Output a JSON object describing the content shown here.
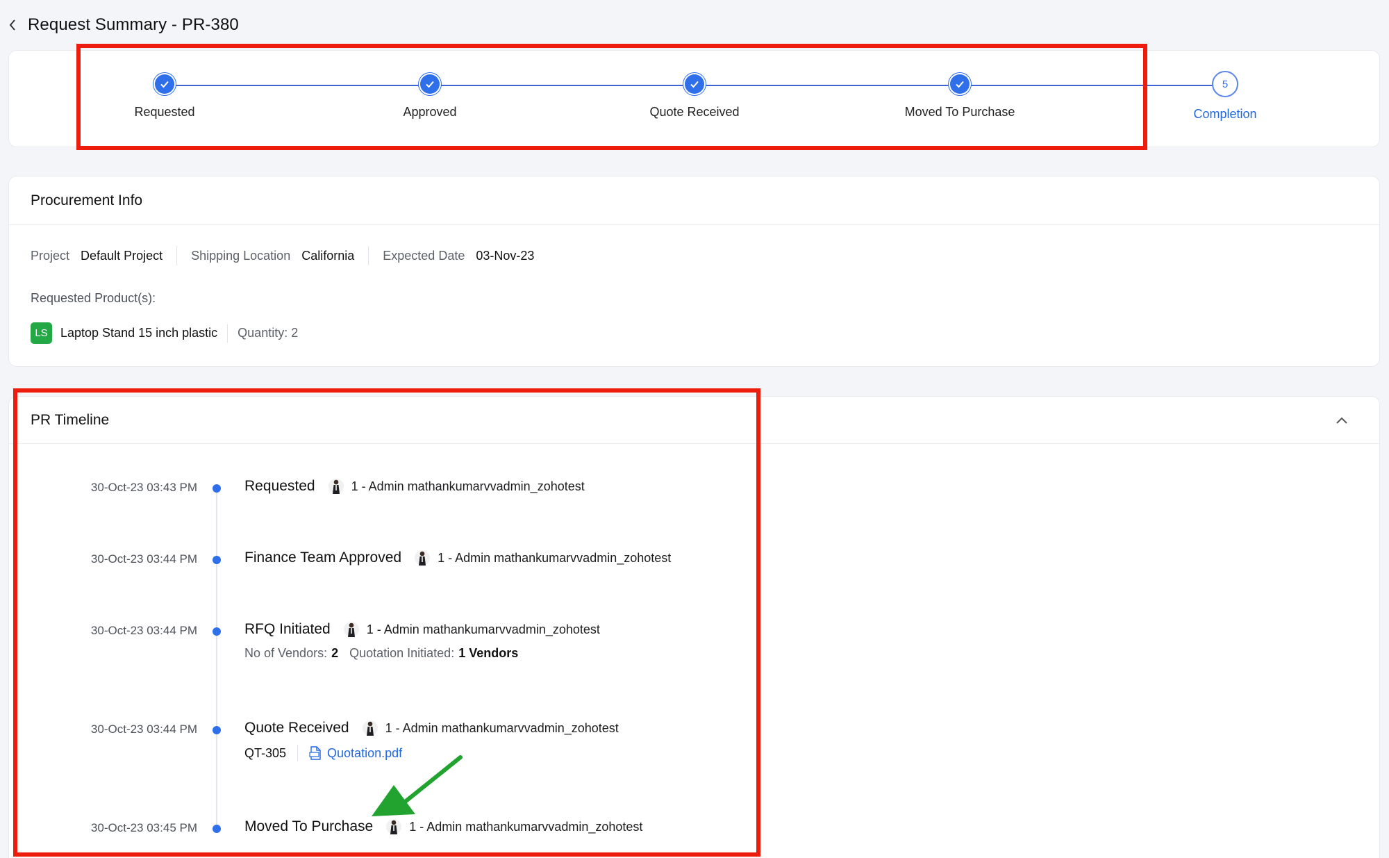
{
  "header": {
    "title": "Request Summary - PR-380"
  },
  "stepper": {
    "steps": [
      {
        "label": "Requested",
        "state": "done"
      },
      {
        "label": "Approved",
        "state": "done"
      },
      {
        "label": "Quote Received",
        "state": "done"
      },
      {
        "label": "Moved To Purchase",
        "state": "done"
      },
      {
        "label": "Completion",
        "state": "pending",
        "number": "5"
      }
    ]
  },
  "procurement": {
    "title": "Procurement Info",
    "project_key": "Project",
    "project_val": "Default Project",
    "shipping_key": "Shipping Location",
    "shipping_val": "California",
    "date_key": "Expected Date",
    "date_val": "03-Nov-23",
    "requested_label": "Requested Product(s):",
    "product": {
      "badge": "LS",
      "name": "Laptop Stand 15 inch plastic",
      "quantity": "Quantity: 2"
    }
  },
  "timeline": {
    "title": "PR Timeline",
    "entries": [
      {
        "time": "30-Oct-23 03:43 PM",
        "event": "Requested",
        "user": "1 - Admin mathankumarvvadmin_zohotest"
      },
      {
        "time": "30-Oct-23 03:44 PM",
        "event": "Finance Team Approved",
        "user": "1 - Admin mathankumarvvadmin_zohotest"
      },
      {
        "time": "30-Oct-23 03:44 PM",
        "event": "RFQ Initiated",
        "user": "1 - Admin mathankumarvvadmin_zohotest",
        "vendors_key": "No of Vendors:",
        "vendors_val": "2",
        "quotation_key": "Quotation Initiated:",
        "quotation_val": "1 Vendors"
      },
      {
        "time": "30-Oct-23 03:44 PM",
        "event": "Quote Received",
        "user": "1 - Admin mathankumarvvadmin_zohotest",
        "quote_id": "QT-305",
        "file": "Quotation.pdf"
      },
      {
        "time": "30-Oct-23 03:45 PM",
        "event": "Moved To Purchase",
        "user": "1 - Admin mathankumarvvadmin_zohotest"
      }
    ]
  },
  "colors": {
    "accent": "#2f6fe9",
    "annotation_red": "#ee1c0c",
    "annotation_green": "#22a32f",
    "product_badge": "#23a845"
  },
  "icons": {
    "back": "chevron-left-icon",
    "check": "check-icon",
    "collapse": "chevron-up-icon",
    "avatar": "user-avatar-icon",
    "file": "pdf-file-icon"
  }
}
